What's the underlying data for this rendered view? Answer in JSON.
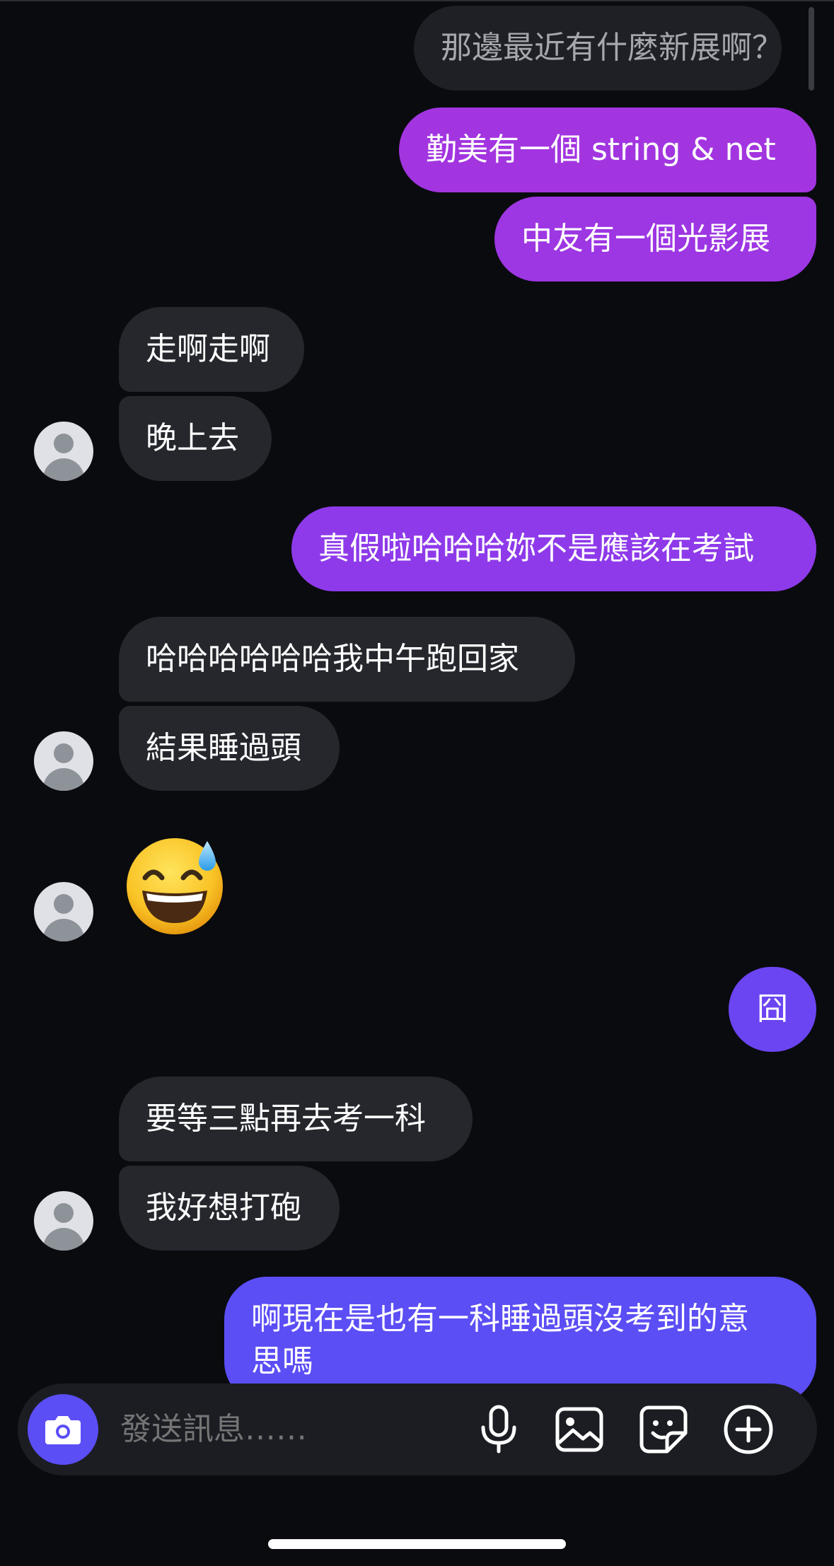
{
  "messages": {
    "m1": "那邊最近有什麼新展啊？",
    "m2": "勤美有一個 string & net",
    "m3": "中友有一個光影展",
    "m4": "走啊走啊",
    "m5": "晚上去",
    "m6": "真假啦哈哈哈妳不是應該在考試",
    "m7": "哈哈哈哈哈哈我中午跑回家",
    "m8": "結果睡過頭",
    "m9_emoji": "grinning-face-with-sweat",
    "m10": "囧",
    "m11": "要等三點再去考一科",
    "m12": "我好想打砲",
    "m13_line1": "啊現在是也有一科睡過頭沒考到的意",
    "m13_line2": "思嗎"
  },
  "composer": {
    "placeholder": "發送訊息……",
    "icons": [
      "camera-icon",
      "microphone-icon",
      "image-icon",
      "sticker-icon",
      "add-icon"
    ]
  },
  "colors": {
    "background": "#0a0b0f",
    "received_bubble": "#25272d",
    "sent_gradient_top": "#a235e0",
    "sent_gradient_mid": "#7b3ff2",
    "sent_gradient_bottom": "#5b4ef5",
    "camera_button": "#5b4ef5"
  }
}
